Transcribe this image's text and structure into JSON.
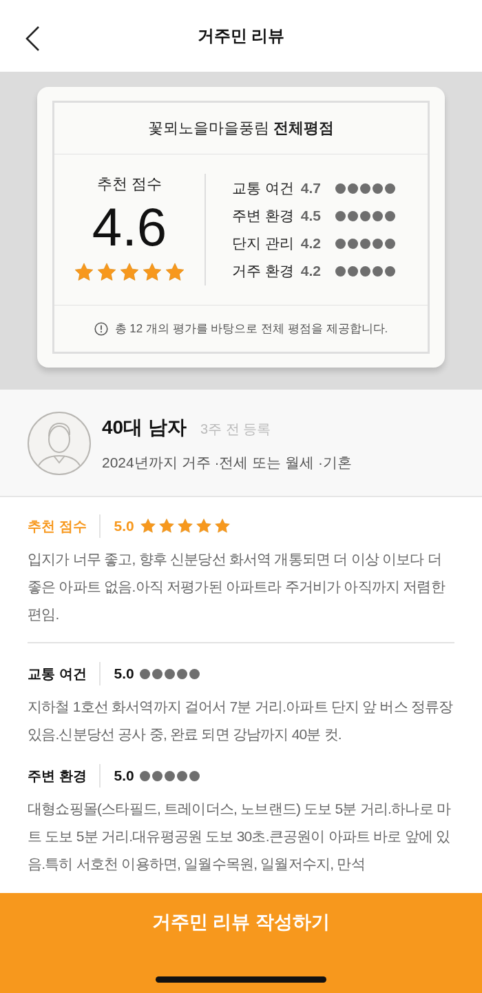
{
  "header": {
    "title": "거주민 리뷰"
  },
  "summary": {
    "title": "꽃뫼노을마을풍림 **전체평점**",
    "score_label": "추천 점수",
    "score": "4.6",
    "stars": 5,
    "categories": [
      {
        "label": "교통 여건",
        "score": "4.7",
        "stars": 5
      },
      {
        "label": "주변 환경",
        "score": "4.5",
        "stars": 5
      },
      {
        "label": "단지 관리",
        "score": "4.2",
        "stars": 5
      },
      {
        "label": "거주 환경",
        "score": "4.2",
        "stars": 5
      }
    ],
    "note": "총 12 개의 평가를 바탕으로 전체 평점을 제공합니다."
  },
  "reviewer": {
    "name": "40대 남자",
    "posted": "3주 전 등록",
    "details": "2024년까지 거주 ·전세 또는 월세 ·기혼"
  },
  "reviews": [
    {
      "kind": "recommend",
      "label": "추천 점수",
      "score": "5.0",
      "stars": 5,
      "text": "입지가 너무 좋고, 향후 신분당선 화서역 개통되면 더 이상 이보다 더 좋은 아파트 없음.아직 저평가된 아파트라 주거비가 아직까지 저렴한 편임."
    },
    {
      "kind": "category",
      "label": "교통 여건",
      "score": "5.0",
      "stars": 5,
      "text": "지하철 1호선 화서역까지 걸어서 7분 거리.아파트 단지 앞 버스 정류장 있음.신분당선 공사 중, 완료 되면 강남까지 40분 컷."
    },
    {
      "kind": "category",
      "label": "주변 환경",
      "score": "5.0",
      "stars": 5,
      "text": "대형쇼핑몰(스타필드, 트레이더스, 노브랜드) 도보 5분 거리.하나로 마트 도보 5분 거리.대유평공원 도보 30초.큰공원이 아파트 바로 앞에 있음.특히 서호천 이용하면, 일월수목원, 일월저수지, 만석"
    }
  ],
  "write_button": "거주민 리뷰 작성하기"
}
